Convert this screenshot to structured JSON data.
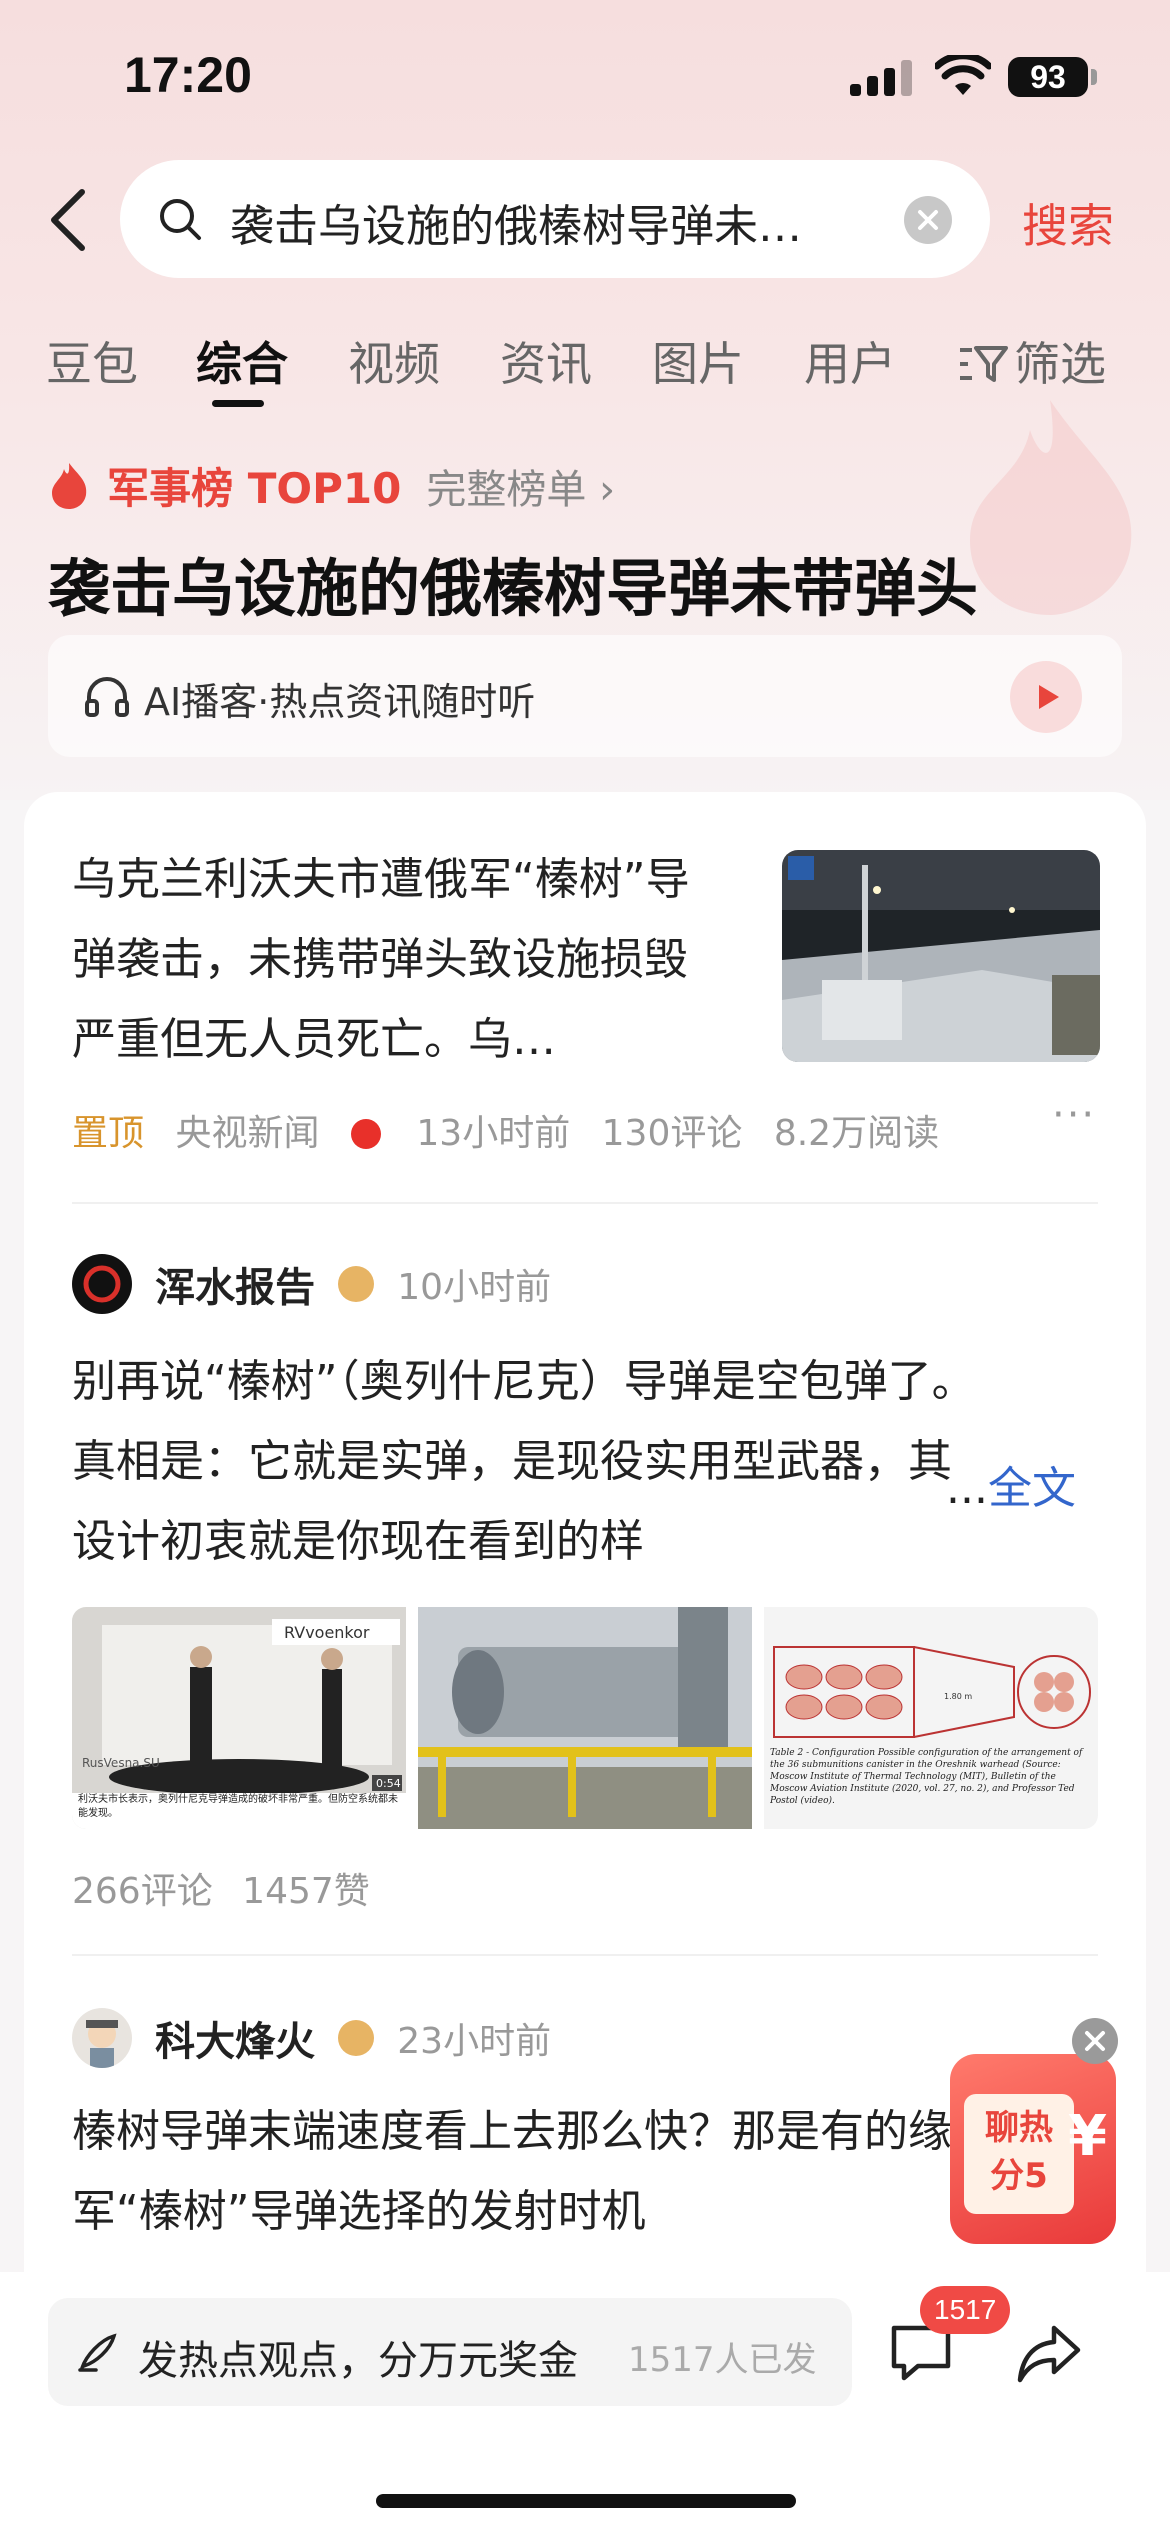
{
  "status_bar": {
    "time": "17:20",
    "battery": "93"
  },
  "search": {
    "query": "袭击乌设施的俄榛树导弹未…",
    "search_label": "搜索"
  },
  "tabs": [
    "豆包",
    "综合",
    "视频",
    "资讯",
    "图片",
    "用户",
    "筛选"
  ],
  "active_tab": "综合",
  "hot_list": {
    "rank_title": "军事榜 TOP10",
    "full_list": "完整榜单 ›",
    "headline": "袭击乌设施的俄榛树导弹未带弹头",
    "ai_podcast": "AI播客·热点资讯随时听"
  },
  "news": {
    "text": "乌克兰利沃夫市遭俄军“榛树”导弹袭击，未携带弹头致设施损毁严重但无人员死亡。乌…",
    "pinned": "置顶",
    "source": "央视新闻",
    "time": "13小时前",
    "comments": "130评论",
    "reads": "8.2万阅读",
    "more": "···"
  },
  "posts": [
    {
      "author": "浑水报告",
      "time": "10小时前",
      "text": "别再说“榛树”（奥列什尼克）导弹是空包弹了。真相是：它就是实弹，是现役实用型武器，其设计初衷就是你现在看到的样",
      "full_text": "全文",
      "ellipsis": "...",
      "comments": "266评论",
      "likes": "1457赞"
    },
    {
      "author": "科大烽火",
      "time": "23小时前",
      "text": "榛树导弹末端速度看上去那么快？那是有的缘故。俄军“榛树”导弹选择的发射时机"
    }
  ],
  "images": {
    "img1_tag": "RVvoenkor",
    "img1_caption": "利沃夫市长表示，奥列什尼克导弹造成的破坏非常严重。但防空系统都未能发现。",
    "img1_watermark": "RusVesna.SU",
    "img1_duration": "0:54",
    "img3_caption": "Table 2 - Configuration Possible configuration of the arrangement of the 36 submunitions canister in the Oreshnik warhead (Source: Moscow Institute of Thermal Technology (MIT), Bulletin of the Moscow Aviation Institute (2020, vol. 27, no. 2), and Professor Ted Postol (video).",
    "img3_dimension": "1.80 m"
  },
  "red_packet": {
    "line1": "聊热",
    "line2": "分5",
    "yen": "¥"
  },
  "bottom": {
    "input_label": "发热点观点，分万元奖金",
    "participants": "1517人已发",
    "comment_badge": "1517"
  },
  "colors": {
    "accent": "#e8453c",
    "link": "#3366cc",
    "gold_badge": "#e7b464"
  }
}
